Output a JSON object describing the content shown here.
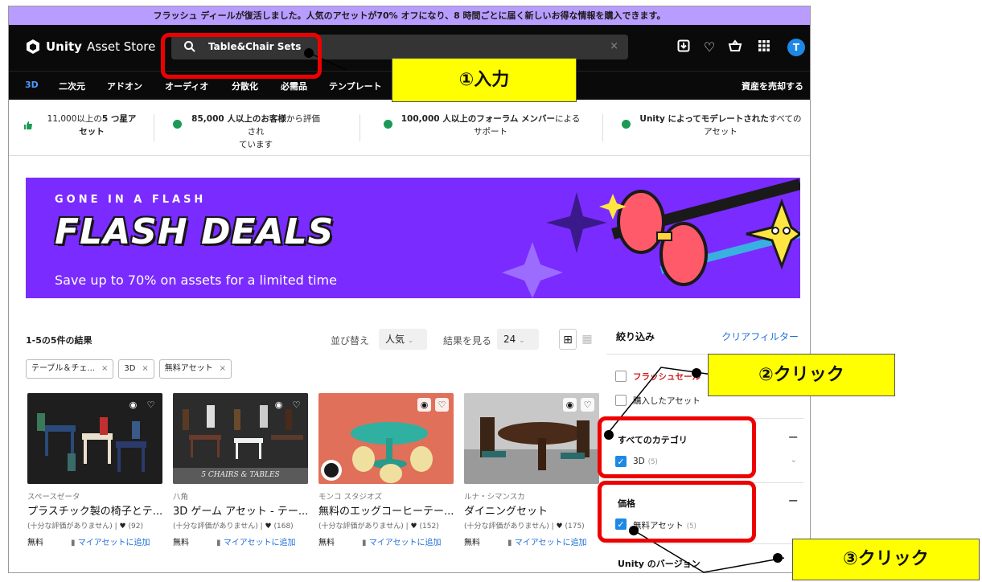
{
  "promo_banner": "フラッシュ ディールが復活しました。人気のアセットが70% オフになり、8 時間ごとに届く新しいお得な情報を購入できます。",
  "header": {
    "logo_brand": "Unity",
    "logo_suffix": "Asset Store",
    "search_value": "Table&Chair Sets",
    "clear_icon": "×",
    "avatar": "T"
  },
  "categories": [
    "3D",
    "二次元",
    "アドオン",
    "オーディオ",
    "分散化",
    "必需品",
    "テンプレート"
  ],
  "sell_link": "資産を売却する",
  "trust": [
    {
      "pre": "11,000以上の",
      "bold": "5 つ星ア",
      "line2": "セット"
    },
    {
      "bold": "85,000 人以上のお客様",
      "post": "から評価され",
      "line2": "ています"
    },
    {
      "bold": "100,000 人以上のフォーラム メンバー",
      "post": "による",
      "line2": "サポート"
    },
    {
      "bold": "Unity によってモデレートされた",
      "post": "すべての",
      "line2": "アセット"
    }
  ],
  "banner": {
    "kicker": "GONE IN A FLASH",
    "headline": "FLASH DEALS",
    "subtitle": "Save up to 70% on assets for a limited time"
  },
  "results": {
    "count": "1-5の5件の結果",
    "sort_label": "並び替え",
    "sort_value": "人気",
    "per_page_label": "結果を見る",
    "per_page_value": "24"
  },
  "chips": [
    "テーブル＆チェ...",
    "3D",
    "無料アセット"
  ],
  "cards": [
    {
      "publisher": "スペースゼータ",
      "title": "プラスチック製の椅子とテ...",
      "rating": "(十分な評価がありません)",
      "likes": "(92)",
      "price": "無料",
      "add": "マイアセットに追加"
    },
    {
      "publisher": "八角",
      "title": "3D ゲーム アセット - テー...",
      "rating": "(十分な評価がありません)",
      "likes": "(168)",
      "price": "無料",
      "add": "マイアセットに追加",
      "thumb_caption": "5 CHAIRS & TABLES"
    },
    {
      "publisher": "モンコ スタジオズ",
      "title": "無料のエッグコーヒーテー...",
      "rating": "(十分な評価がありません)",
      "likes": "(152)",
      "price": "無料",
      "add": "マイアセットに追加"
    },
    {
      "publisher": "ルナ・シマンスカ",
      "title": "ダイニングセット",
      "rating": "(十分な評価がありません)",
      "likes": "(175)",
      "price": "無料",
      "add": "マイアセットに追加"
    }
  ],
  "filters": {
    "title": "絞り込み",
    "clear": "クリアフィルター",
    "flash_sale": "フラッシュセール",
    "purchased": "購入したアセット",
    "category_head": "すべてのカテゴリ",
    "category_item": "3D",
    "category_count": "(5)",
    "price_head": "価格",
    "price_item": "無料アセット",
    "price_count": "(5)",
    "version_head": "Unity のバージョン"
  },
  "annotations": {
    "step1": "①入力",
    "step2": "②クリック",
    "step3": "③クリック"
  },
  "colors": {
    "promo": "#b99cff",
    "nav": "#0a0a0a",
    "link": "#1e6fd9",
    "banner": "#7a2bff",
    "callout": "#ffff00",
    "highlight": "#ee0000"
  }
}
